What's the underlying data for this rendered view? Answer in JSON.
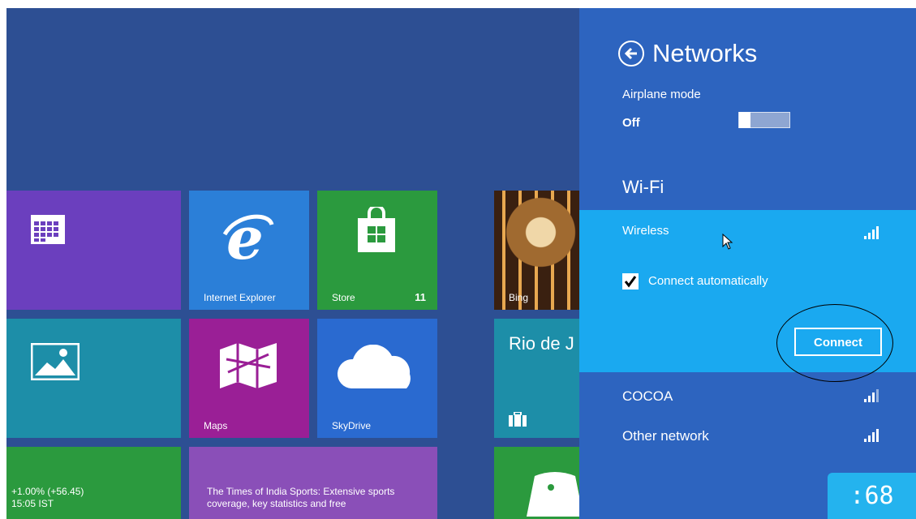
{
  "start_screen": {
    "tiles": {
      "internet_explorer": {
        "label": "Internet Explorer"
      },
      "store": {
        "label": "Store",
        "badge": "11"
      },
      "bing": {
        "label": "Bing"
      },
      "maps": {
        "label": "Maps"
      },
      "skydrive": {
        "label": "SkyDrive"
      },
      "weather": {
        "text": "Rio de J"
      },
      "finance": {
        "line1": "+1.00% (+56.45)",
        "line2": "15:05 IST"
      },
      "news": {
        "text": "The Times of India Sports: Extensive sports coverage, key statistics and free"
      }
    }
  },
  "networks_panel": {
    "title": "Networks",
    "airplane_mode": {
      "label": "Airplane mode",
      "value": "Off"
    },
    "wifi_heading": "Wi-Fi",
    "networks": [
      {
        "name": "Wireless",
        "selected": true,
        "connect_automatically": true,
        "connect_label": "Connect automatically",
        "connect_button": "Connect"
      },
      {
        "name": "COCOA"
      },
      {
        "name": "Other network"
      }
    ]
  },
  "clock": ":68",
  "colors": {
    "panel": "#2d64bf",
    "selected_network": "#1aa9f0",
    "desktop": "#2d4f93"
  }
}
